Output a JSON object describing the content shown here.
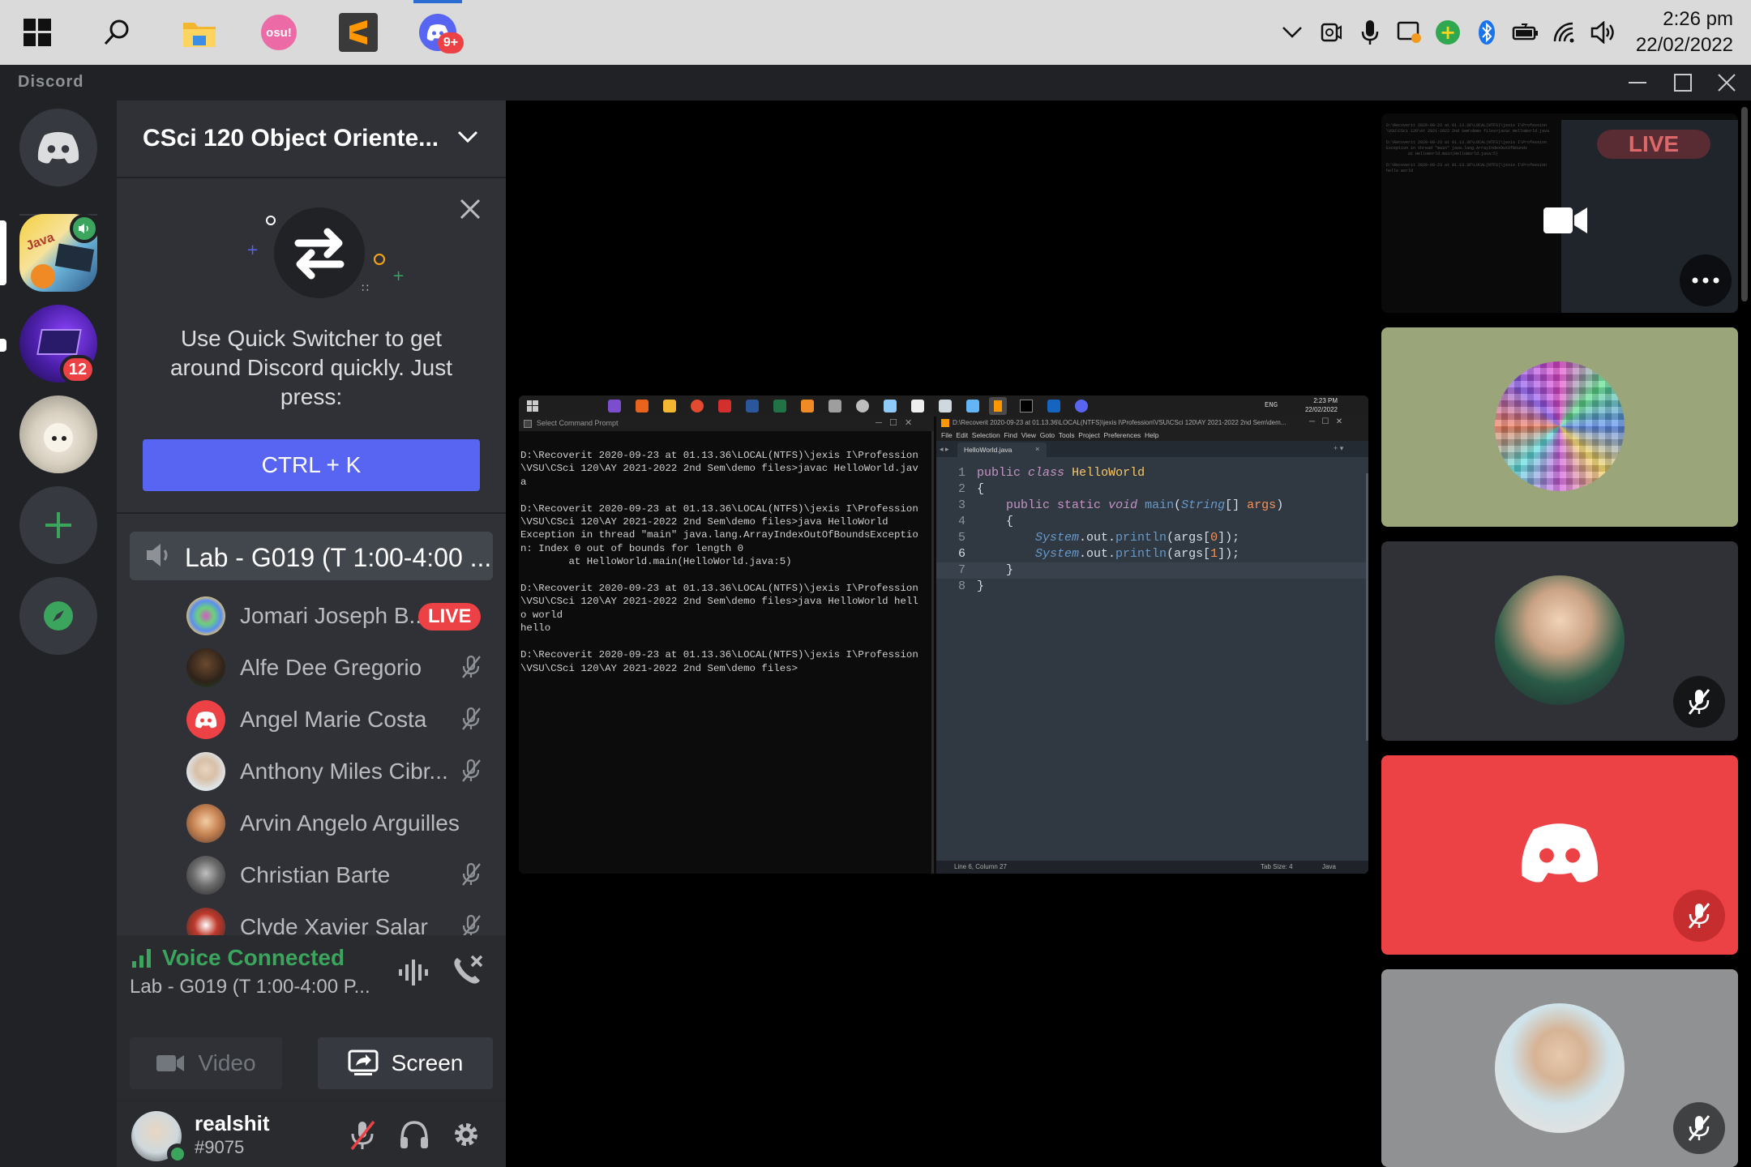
{
  "taskbar": {
    "clock_time": "2:26 pm",
    "clock_date": "22/02/2022",
    "osu_label": "osu!",
    "discord_badge": "9+"
  },
  "app": {
    "brand": "Discord"
  },
  "servers": {
    "badge_count": "12"
  },
  "guild": {
    "name": "CSci 120 Object Oriente..."
  },
  "quick_switcher": {
    "text": "Use Quick Switcher to get around Discord quickly. Just press:",
    "shortcut": "CTRL + K"
  },
  "voice_channel": {
    "name": "Lab - G019 (T 1:00-4:00 ..."
  },
  "members": [
    {
      "name": "Jomari Joseph B...",
      "live": "LIVE"
    },
    {
      "name": "Alfe Dee Gregorio"
    },
    {
      "name": "Angel Marie Costa"
    },
    {
      "name": "Anthony Miles Cibr..."
    },
    {
      "name": "Arvin Angelo Arguilles"
    },
    {
      "name": "Christian Barte"
    },
    {
      "name": "Clyde Xavier Salar"
    }
  ],
  "voice_status": {
    "connected": "Voice Connected",
    "channel": "Lab - G019 (T 1:00-4:00 P...",
    "video_label": "Video",
    "screen_label": "Screen"
  },
  "user": {
    "name": "realshit",
    "tag": "#9075"
  },
  "stream": {
    "cmd_title": "Select Command Prompt",
    "cmd_lines": [
      "D:\\Recoverit 2020-09-23 at 01.13.36\\LOCAL(NTFS)\\jexis I\\Profession",
      "\\VSU\\CSci 120\\AY 2021-2022 2nd Sem\\demo files>javac HelloWorld.jav",
      "a",
      "",
      "D:\\Recoverit 2020-09-23 at 01.13.36\\LOCAL(NTFS)\\jexis I\\Profession",
      "\\VSU\\CSci 120\\AY 2021-2022 2nd Sem\\demo files>java HelloWorld",
      "Exception in thread \"main\" java.lang.ArrayIndexOutOfBoundsExceptio",
      "n: Index 0 out of bounds for length 0",
      "        at HelloWorld.main(HelloWorld.java:5)",
      "",
      "D:\\Recoverit 2020-09-23 at 01.13.36\\LOCAL(NTFS)\\jexis I\\Profession",
      "\\VSU\\CSci 120\\AY 2021-2022 2nd Sem\\demo files>java HelloWorld hell",
      "o world",
      "hello",
      "",
      "D:\\Recoverit 2020-09-23 at 01.13.36\\LOCAL(NTFS)\\jexis I\\Profession",
      "\\VSU\\CSci 120\\AY 2021-2022 2nd Sem\\demo files>"
    ],
    "editor_title": "D:\\Recoverit 2020-09-23 at 01.13.36\\LOCAL(NTFS)\\jexis I\\Profession\\VSU\\CSci 120\\AY 2021-2022 2nd Sem\\dem...",
    "editor_menu": "File  Edit  Selection  Find  View  Goto  Tools  Project  Preferences  Help",
    "editor_tab": "HelloWorld.java",
    "code_lines": [
      "public class HelloWorld",
      "{",
      "    public static void main(String[] args)",
      "    {",
      "        System.out.println(args[0]);",
      "        System.out.println(args[1]);",
      "    }",
      "}"
    ],
    "status_left": "Line 6, Column 27",
    "status_tab": "Tab Size: 4",
    "status_lang": "Java",
    "inner_clock_time": "2:23 PM",
    "inner_clock_date": "22/02/2022",
    "inner_lang": "ENG"
  },
  "tiles": {
    "live_label": "LIVE"
  },
  "colors": {
    "blurple": "#5865f2",
    "green": "#3ba55d",
    "red": "#ed4245"
  }
}
